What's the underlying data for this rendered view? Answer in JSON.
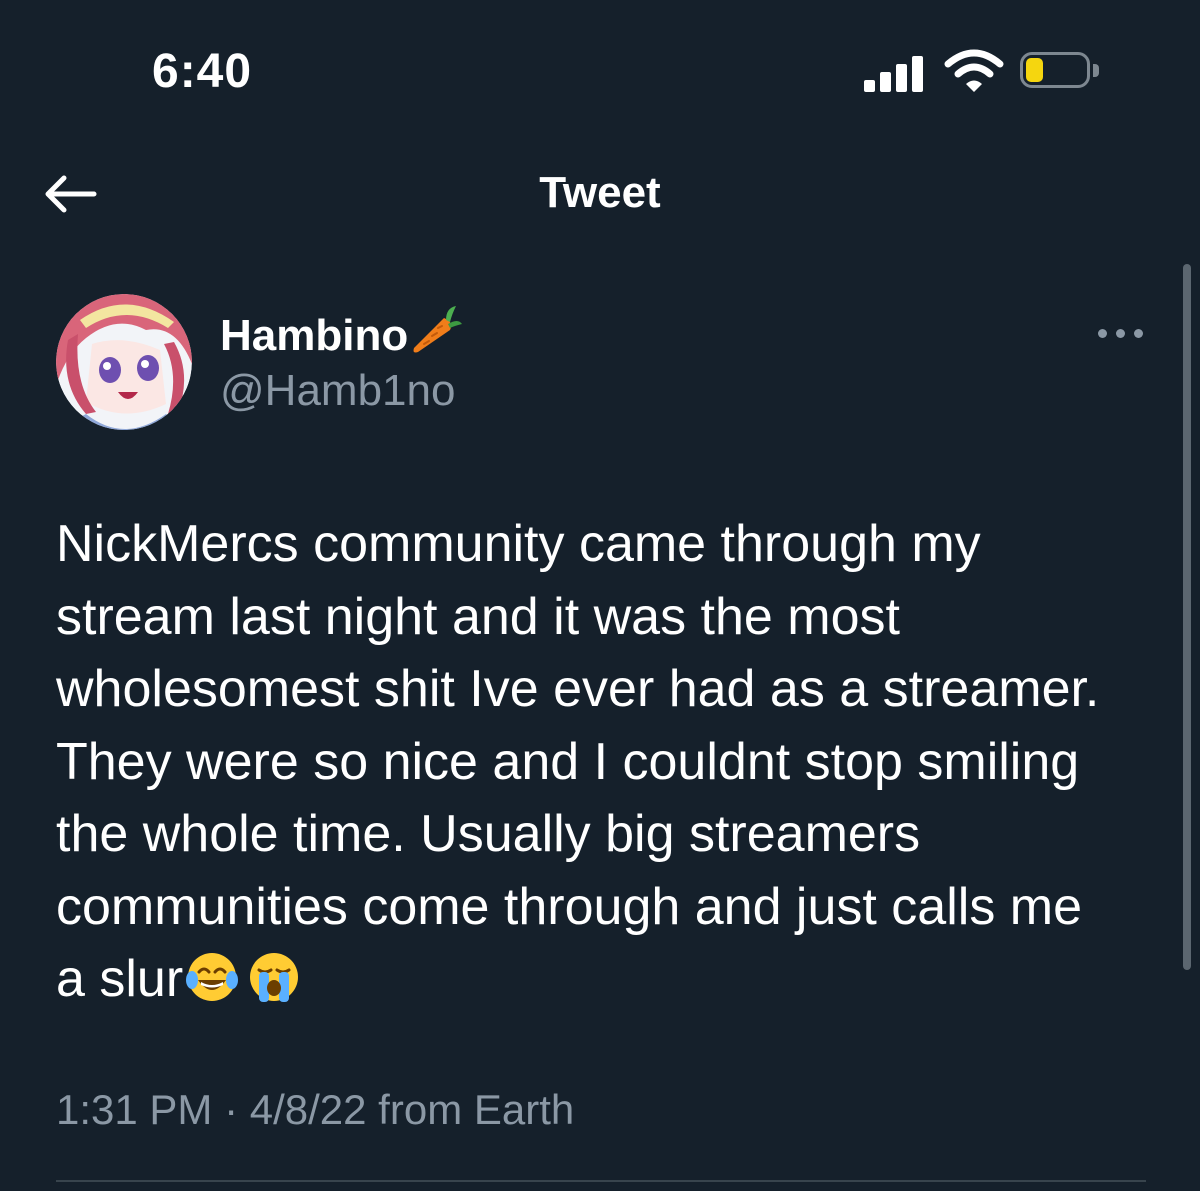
{
  "status_bar": {
    "time": "6:40",
    "signal_icon": "cellular-signal-icon",
    "wifi_icon": "wifi-icon",
    "battery_icon": "battery-low-icon",
    "battery_level": 0.3,
    "battery_color": "#f5d60f"
  },
  "nav": {
    "title": "Tweet",
    "back_icon": "arrow-left-icon"
  },
  "author": {
    "display_name": "Hambino",
    "name_emoji": "🥕",
    "handle": "@Hamb1no",
    "avatar_icon": "anime-avatar-image",
    "more_icon": "more-horizontal-icon"
  },
  "tweet": {
    "text_lines": [
      "NickMercs community came through my",
      "stream last night and it was the most",
      "wholesomest shit Ive ever had as a streamer.",
      "They were so nice and I couldnt stop smiling",
      "the whole time. Usually big streamers",
      "communities come through and just calls me",
      "a slur"
    ],
    "trailing_emojis": [
      "😂",
      "😭"
    ],
    "timestamp": "1:31 PM · 4/8/22 from Earth"
  },
  "colors": {
    "background": "#15202b",
    "text": "#ffffff",
    "secondary_text": "#8b98a5",
    "divider": "#38444d"
  }
}
